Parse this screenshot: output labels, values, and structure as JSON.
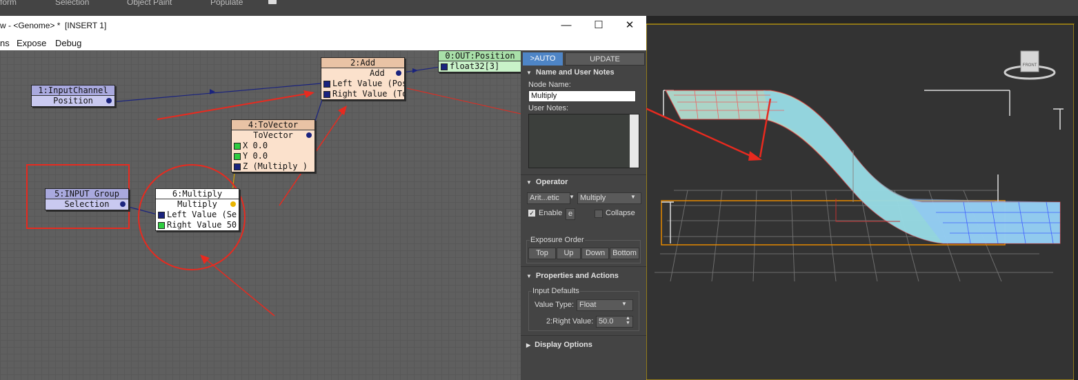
{
  "top_toolbar": {
    "items": [
      "form",
      "Selection",
      "Object Paint",
      "Populate"
    ]
  },
  "window": {
    "title": "w - <Genome> *  [INSERT 1]",
    "minimize_glyph": "—",
    "maximize_glyph": "☐",
    "close_glyph": "✕"
  },
  "menu": {
    "items": [
      "ns",
      "Expose",
      "Debug"
    ]
  },
  "nodes": {
    "input_channel": {
      "header": "1:InputChannel",
      "port": "Position"
    },
    "add": {
      "header": "2:Add",
      "out": "Add",
      "left": "Left Value (Pos",
      "right": "Right Value (To"
    },
    "out_position": {
      "header": "0:OUT:Position",
      "port": "float32[3]"
    },
    "to_vector": {
      "header": "4:ToVector",
      "out": "ToVector",
      "x": "X 0.0",
      "y": "Y 0.0",
      "z": "Z (Multiply )"
    },
    "input_group": {
      "header": "5:INPUT Group",
      "port": "Selection"
    },
    "multiply": {
      "header": "6:Multiply",
      "out": "Multiply",
      "left": "Left Value (Se",
      "right": "Right Value 50."
    }
  },
  "panel": {
    "auto_btn": ">AUTO",
    "update_btn": "UPDATE",
    "name_section": "Name and User Notes",
    "node_name_label": "Node Name:",
    "node_name_value": "Multiply",
    "user_notes_label": "User Notes:",
    "operator_section": "Operator",
    "op_category": "Arit...etic",
    "op_type": "Multiply",
    "enable_label": "Enable",
    "e_btn": "e",
    "collapse_label": "Collapse",
    "exposure_label": "Exposure Order",
    "order_btns": [
      "Top",
      "Up",
      "Down",
      "Bottom"
    ],
    "props_section": "Properties and Actions",
    "input_defaults_label": "Input Defaults",
    "value_type_label": "Value Type:",
    "value_type_value": "Float",
    "right_value_label": "2:Right Value:",
    "right_value_value": "50.0",
    "display_section": "Display Options"
  },
  "viewport": {
    "gizmo_label": "FRONT"
  },
  "colors": {
    "annotation_red": "#e82a1f",
    "node_input": "#c9c9f0",
    "node_input_header": "#a9a9de",
    "node_op": "#fbe1cc",
    "node_op_header": "#e9c3a5",
    "node_out": "#c9f2c9",
    "node_out_header": "#a9e0a9",
    "auto_btn": "#4e85c6"
  }
}
